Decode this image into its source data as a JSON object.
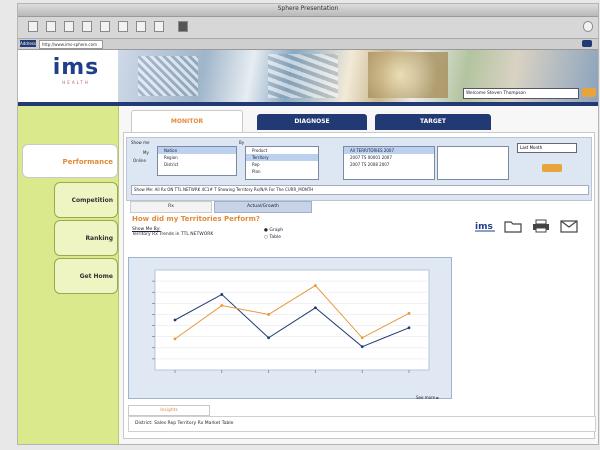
{
  "window": {
    "title": "Sphere Presentation"
  },
  "address": {
    "label": "Address",
    "value": "http://www.ims-sphere.com"
  },
  "logo": {
    "name": "ims",
    "tagline": "HEALTH"
  },
  "welcome": {
    "text": "Welcome Steven Thompson"
  },
  "nav": {
    "items": [
      {
        "label": "Performance",
        "active": true
      },
      {
        "label": "Competition",
        "active": false
      },
      {
        "label": "Ranking",
        "active": false
      },
      {
        "label": "Get Home",
        "active": false
      }
    ]
  },
  "tabs": [
    {
      "label": "MONITOR",
      "active": true
    },
    {
      "label": "DIAGNOSE",
      "active": false
    },
    {
      "label": "TARGET",
      "active": false
    }
  ],
  "filters": {
    "show_label": "Show me",
    "by_label": "By",
    "by_options": [
      "My",
      "Online"
    ],
    "list1": [
      "Nation",
      "Region",
      "District"
    ],
    "list1_selected": 0,
    "list2": [
      "Product",
      "Territory",
      "Rep",
      "Plan"
    ],
    "list2_selected": 1,
    "list3": [
      "All TERRITORIES 2007",
      "2007 TS 00001 2007",
      "2007 TS 2008 2007"
    ],
    "list3_selected": 0,
    "select_value": "Last Month",
    "showme_text": "Show Me:  All Rx ON TTL NETWRK 4C1# T Showing Territory Rx/N/A For The CURR_MONTH"
  },
  "subtabs": [
    "Rx",
    "Actual/Growth"
  ],
  "question": "How did my Territories Perform?",
  "showby": {
    "label": "Show Me By:",
    "value": "Territory Rx Trends in TTL NETWORK"
  },
  "view_options": [
    "Graph",
    "Table"
  ],
  "chart_data": {
    "type": "line",
    "categories": [
      "1",
      "2",
      "3",
      "4",
      "5",
      "6"
    ],
    "series": [
      {
        "values": [
          45,
          68,
          29,
          56,
          21,
          38
        ],
        "color": "#223a73"
      },
      {
        "values": [
          28,
          58,
          50,
          76,
          29,
          51
        ],
        "color": "#e89a3c"
      }
    ],
    "ylim": [
      0,
      90
    ]
  },
  "see_more": "See more ►",
  "bottom_tab": "Insights",
  "bottom_text": "District: Sales Rep Territory Rx Market Table"
}
